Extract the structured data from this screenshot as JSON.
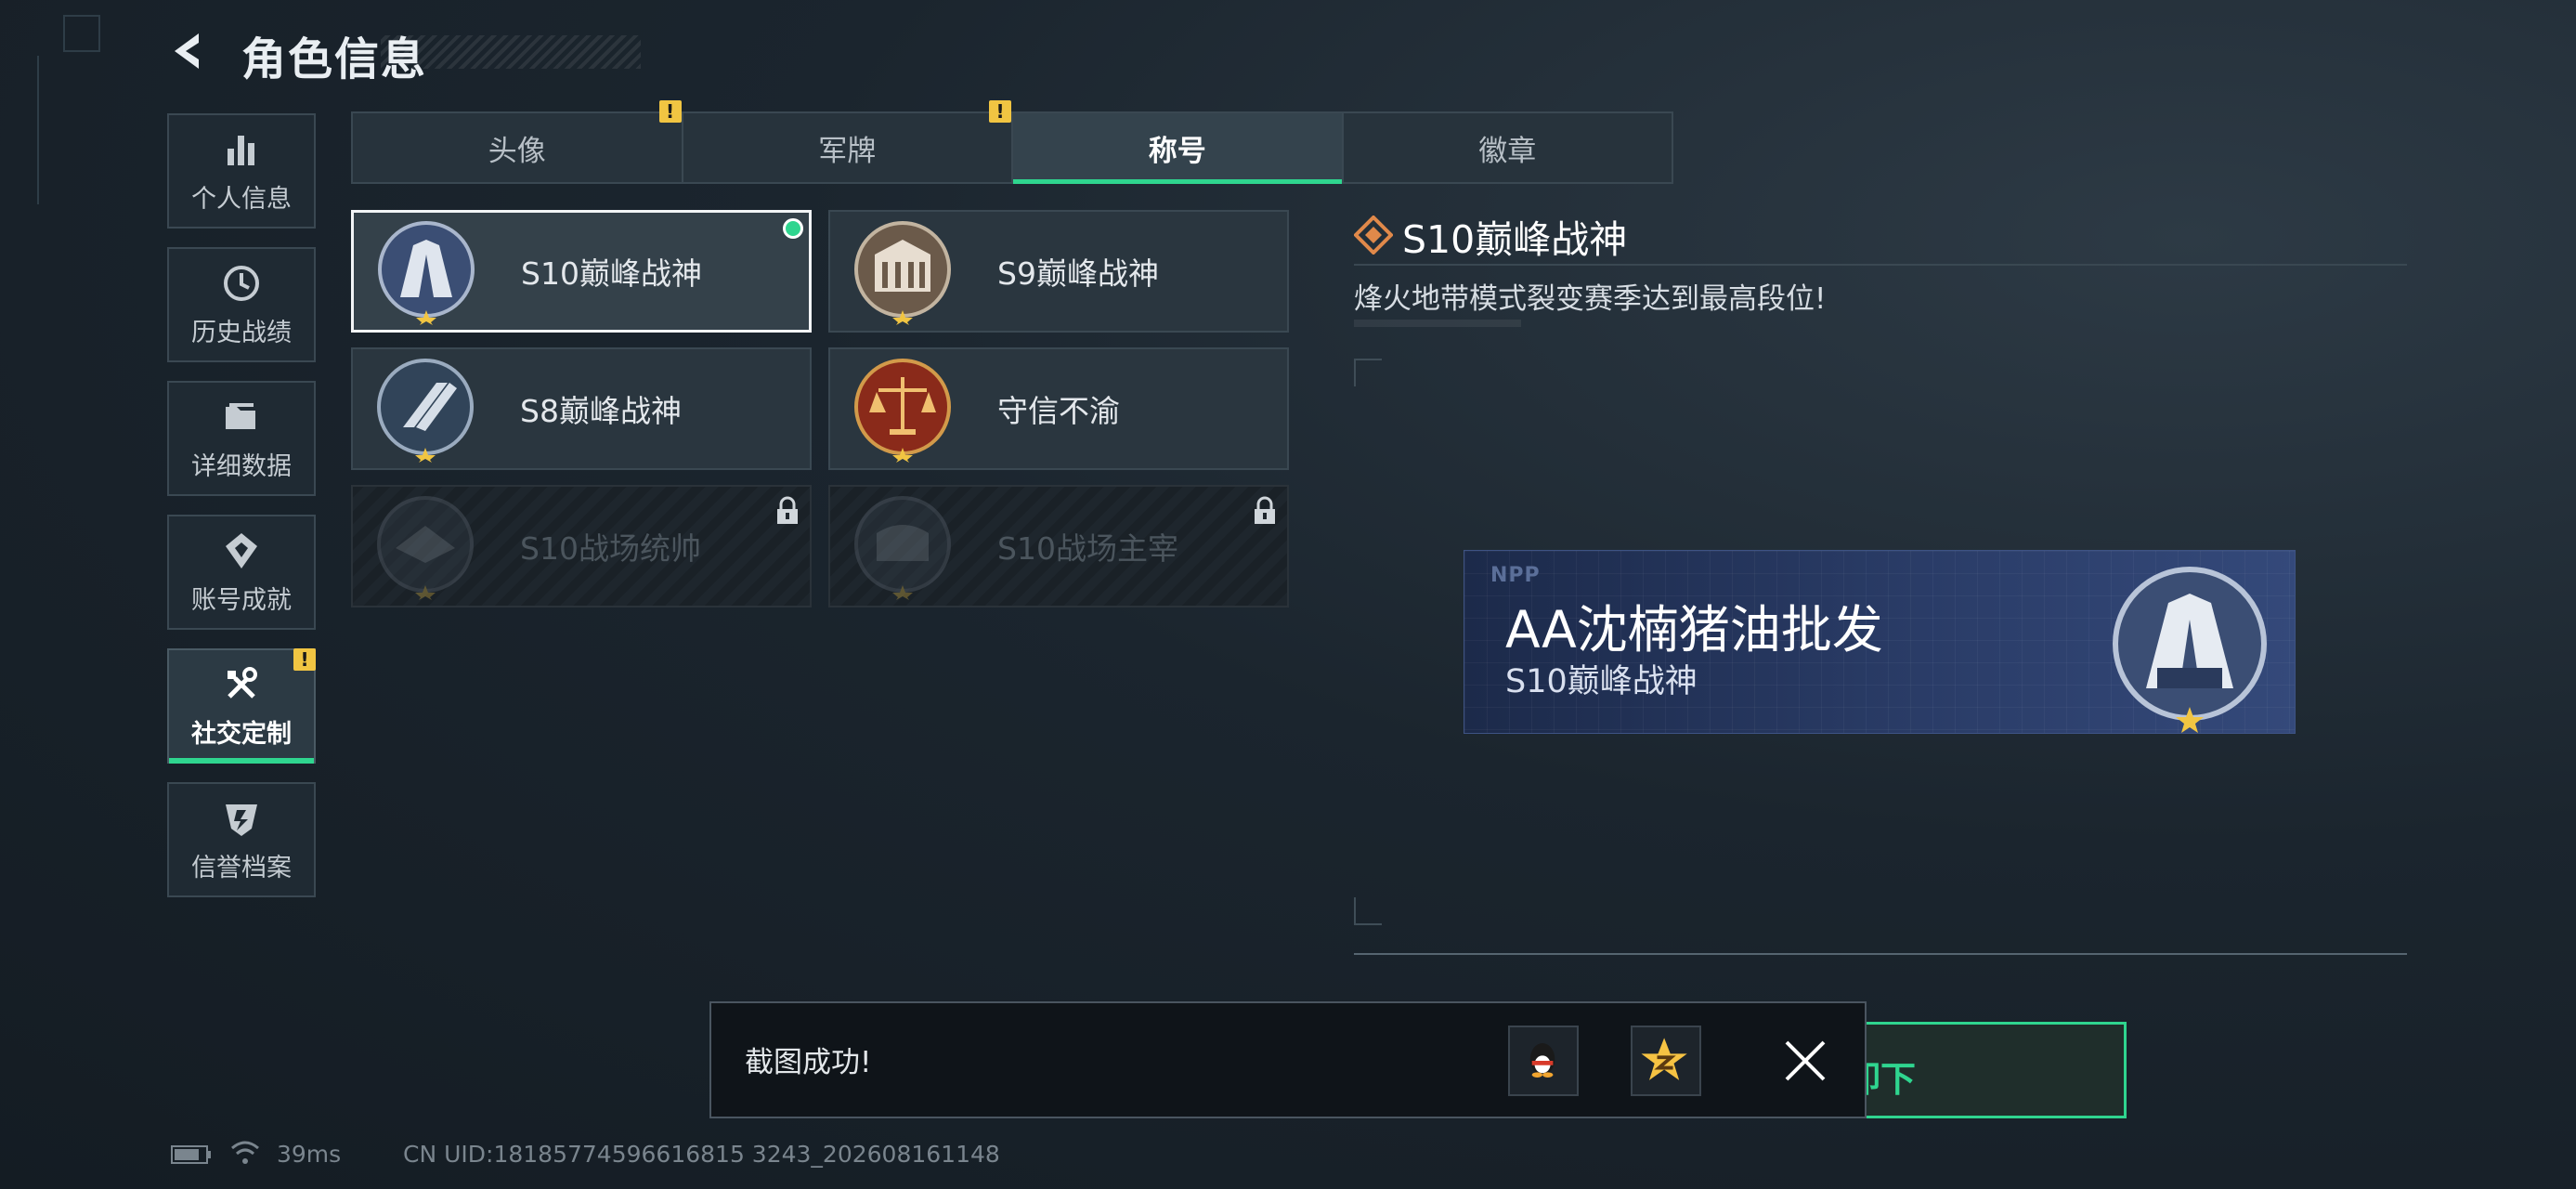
{
  "header": {
    "title": "角色信息"
  },
  "sidebar": {
    "items": [
      {
        "label": "个人信息",
        "icon": "bar-chart-icon"
      },
      {
        "label": "历史战绩",
        "icon": "clock-icon"
      },
      {
        "label": "详细数据",
        "icon": "folder-icon"
      },
      {
        "label": "账号成就",
        "icon": "achievement-icon"
      },
      {
        "label": "社交定制",
        "icon": "tools-icon",
        "active": true,
        "alert": "!"
      },
      {
        "label": "信誉档案",
        "icon": "credit-shield-icon"
      }
    ]
  },
  "tabs": [
    {
      "label": "头像",
      "alert": "!"
    },
    {
      "label": "军牌",
      "alert": "!"
    },
    {
      "label": "称号",
      "active": true
    },
    {
      "label": "徽章"
    }
  ],
  "cards": [
    {
      "label": "S10巅峰战神",
      "selected": true,
      "equipped": true,
      "locked": false
    },
    {
      "label": "S9巅峰战神",
      "selected": false,
      "locked": false
    },
    {
      "label": "S8巅峰战神",
      "selected": false,
      "locked": false
    },
    {
      "label": "守信不渝",
      "selected": false,
      "locked": false
    },
    {
      "label": "S10战场统帅",
      "selected": false,
      "locked": true
    },
    {
      "label": "S10战场主宰",
      "selected": false,
      "locked": true
    }
  ],
  "detail": {
    "title": "S10巅峰战神",
    "description": "烽火地带模式裂变赛季达到最高段位!"
  },
  "nameplate": {
    "logo": "NPP",
    "player_name": "AA沈楠猪油批发",
    "title": "S10巅峰战神"
  },
  "equip_button": {
    "label": "卸下"
  },
  "toast": {
    "message": "截图成功!",
    "share": [
      "qq-share-icon",
      "qzone-share-icon"
    ]
  },
  "status": {
    "ping": "39ms",
    "uid": "CN UID:18185774596616815 3243_202608161148"
  },
  "colors": {
    "accent": "#2fd58f",
    "warning": "#f1c542",
    "background": "#1b252e"
  }
}
